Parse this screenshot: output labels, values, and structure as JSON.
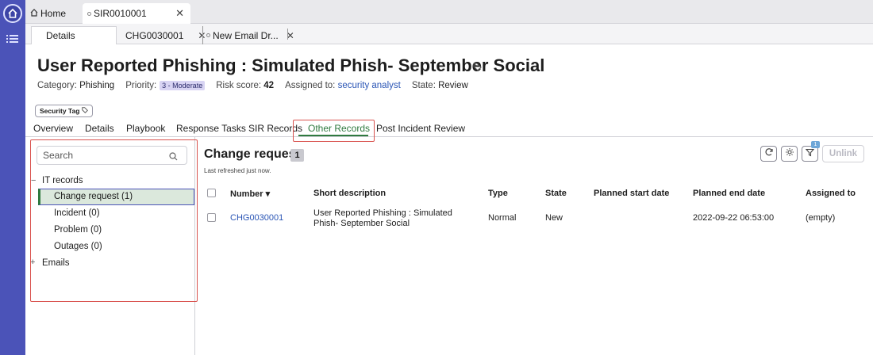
{
  "top_tabs": [
    {
      "label": "Home"
    },
    {
      "label": "SIR0010001"
    }
  ],
  "sub_tabs": [
    {
      "label": "Details"
    },
    {
      "label": "CHG0030001"
    },
    {
      "label": "New Email Dr..."
    }
  ],
  "record": {
    "title": "User Reported Phishing : Simulated Phish- September Social",
    "category_label": "Category:",
    "category_value": "Phishing",
    "priority_label": "Priority:",
    "priority_value": "3 - Moderate",
    "risk_label": "Risk score:",
    "risk_value": "42",
    "assigned_label": "Assigned to:",
    "assigned_value": "security analyst",
    "state_label": "State:",
    "state_value": "Review",
    "security_tag": "Security Tag"
  },
  "record_tabs": [
    {
      "label": "Overview"
    },
    {
      "label": "Details"
    },
    {
      "label": "Playbook"
    },
    {
      "label": "Response Tasks"
    },
    {
      "label": "SIR Records"
    },
    {
      "label": "Other Records",
      "active": true
    },
    {
      "label": "Post Incident Review"
    }
  ],
  "left_panel": {
    "search_placeholder": "Search",
    "groups": [
      {
        "label": "IT records",
        "toggle": "−",
        "items": [
          {
            "label": "Change request (1)",
            "selected": true
          },
          {
            "label": "Incident (0)"
          },
          {
            "label": "Problem (0)"
          },
          {
            "label": "Outages (0)"
          }
        ]
      },
      {
        "label": "Emails",
        "toggle": "+"
      }
    ]
  },
  "main": {
    "title": "Change request",
    "count": "1",
    "refreshed": "Last refreshed just now.",
    "filter_badge": "1",
    "unlink_label": "Unlink",
    "columns": [
      "Number ▾",
      "Short description",
      "Type",
      "State",
      "Planned start date",
      "Planned end date",
      "Assigned to"
    ],
    "rows": [
      {
        "number": "CHG0030001",
        "short_description_line1": "User Reported Phishing : Simulated",
        "short_description_line2": "Phish- September Social",
        "type": "Normal",
        "state": "New",
        "planned_start": "",
        "planned_end": "2022-09-22 06:53:00",
        "assigned_to": "(empty)"
      }
    ]
  },
  "colors": {
    "rail": "#4b53b8",
    "accent_green": "#2f7a3f",
    "highlight_red": "#d9534f",
    "link_blue": "#2a55b5"
  }
}
